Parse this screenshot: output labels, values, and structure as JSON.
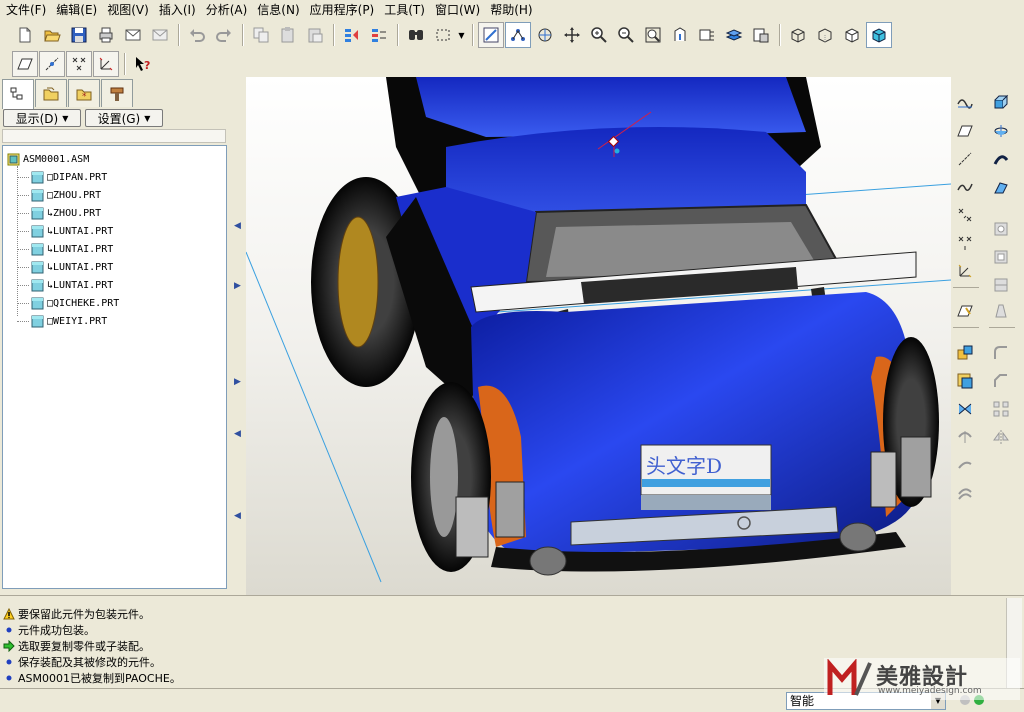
{
  "menu": {
    "items": [
      "文件(F)",
      "编辑(E)",
      "视图(V)",
      "插入(I)",
      "分析(A)",
      "信息(N)",
      "应用程序(P)",
      "工具(T)",
      "窗口(W)",
      "帮助(H)"
    ]
  },
  "toolbar1": {
    "icons": [
      "new-file-icon",
      "open-folder-icon",
      "save-icon",
      "print-icon",
      "mail-icon",
      "mail-attach-icon",
      "undo-icon",
      "redo-icon",
      "copy-icon",
      "paste-icon",
      "paste-special-icon",
      "regenerate-icon",
      "regenerate-manager-icon",
      "find-icon",
      "select-box-icon",
      "datum-display-icon",
      "spin-center-icon",
      "orient-mode-icon",
      "pan-icon",
      "zoom-in-icon",
      "zoom-out-icon",
      "refit-icon",
      "reorient-icon",
      "saved-views-icon",
      "layers-icon",
      "view-manager-icon",
      "wireframe-icon",
      "hidden-line-icon",
      "no-hidden-icon",
      "shading-icon"
    ]
  },
  "toolbar2": {
    "icons": [
      "datum-planes-toggle-icon",
      "datum-axes-toggle-icon",
      "datum-points-toggle-icon",
      "coordinate-systems-toggle-icon",
      "context-help-icon"
    ]
  },
  "panel": {
    "show_button": "显示(D)",
    "settings_button": "设置(G)"
  },
  "model_tree": {
    "root": "ASM0001.ASM",
    "items": [
      {
        "label": "DIPAN.PRT",
        "flag": "□"
      },
      {
        "label": "ZHOU.PRT",
        "flag": "□"
      },
      {
        "label": "ZHOU.PRT",
        "flag": "↳"
      },
      {
        "label": "LUNTAI.PRT",
        "flag": "↳"
      },
      {
        "label": "LUNTAI.PRT",
        "flag": "↳"
      },
      {
        "label": "LUNTAI.PRT",
        "flag": "↳"
      },
      {
        "label": "LUNTAI.PRT",
        "flag": "↳"
      },
      {
        "label": "QICHEKE.PRT",
        "flag": "□"
      },
      {
        "label": "WEIYI.PRT",
        "flag": "□"
      }
    ]
  },
  "graphics": {
    "license_plate_text": "头文字D"
  },
  "right_toolbar": {
    "icons": [
      "sketch-icon",
      "extrude-icon",
      "datum-plane-icon",
      "revolve-icon",
      "datum-axis-icon",
      "variable-sweep-icon",
      "datum-curve-icon",
      "blend-icon",
      "datum-point-icon",
      "hole-icon",
      "datum-point-offset-icon",
      "shell-icon",
      "coordinate-system-icon",
      "rib-icon",
      "analysis-feature-icon",
      "draft-icon",
      "component-assemble-icon",
      "round-icon",
      "component-create-icon",
      "chamfer-icon",
      "merge-icon",
      "pattern-icon",
      "trim-icon",
      "mirror-icon",
      "extend-icon",
      "offset-icon"
    ]
  },
  "messages": [
    {
      "icon": "warning-icon",
      "text": "要保留此元件为包装元件。"
    },
    {
      "icon": "info-dot-icon",
      "text": "元件成功包装。"
    },
    {
      "icon": "prompt-arrow-icon",
      "text": "选取要复制零件或子装配。"
    },
    {
      "icon": "info-dot-icon",
      "text": "保存装配及其被修改的元件。"
    },
    {
      "icon": "info-dot-icon",
      "text": "ASM0001已被复制到PAOCHE。"
    }
  ],
  "status": {
    "filter_value": "智能"
  },
  "watermark": {
    "brand": "美雅設計",
    "url": "www.meiyadesign.com"
  },
  "colors": {
    "car_body": "#1a2ecc",
    "accent_orange": "#d9661a",
    "background": "#ece9d8",
    "tree_border": "#7f9db9"
  }
}
